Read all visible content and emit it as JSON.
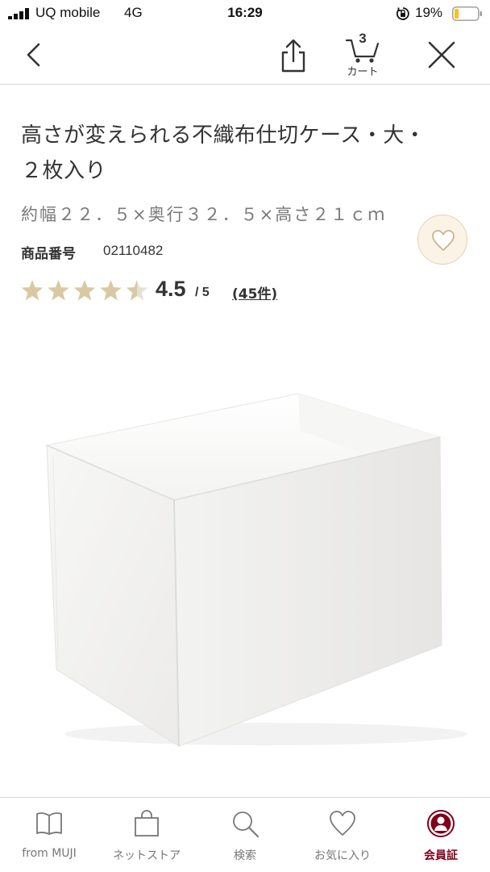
{
  "status_bar": {
    "carrier": "UQ mobile",
    "network": "4G",
    "time": "16:29",
    "battery": "19%",
    "battery_level": 0.19,
    "icons": [
      "signal-icon",
      "orientation-lock-icon",
      "battery-icon"
    ]
  },
  "nav": {
    "icons": [
      "chevron-left-icon",
      "share-icon",
      "cart-icon",
      "close-icon"
    ],
    "cart_count": "3",
    "cart_label": "カート"
  },
  "product": {
    "title_line1": "高さが変えられる不織布仕切ケース・大・",
    "title_line2": "２枚入り",
    "size": "約幅２２．５×奥行３２．５×高さ２１ｃｍ",
    "product_number_label": "商品番号",
    "product_number": "02110482",
    "rating": "4.5",
    "rating_max": "/ 5",
    "rating_value": 4.5,
    "review_count": "(45件)",
    "favorite_icon": "heart-icon"
  },
  "tabs": [
    {
      "label": "from MUJI",
      "icon": "book-icon"
    },
    {
      "label": "ネットストア",
      "icon": "shopping-bag-icon"
    },
    {
      "label": "検索",
      "icon": "search-icon"
    },
    {
      "label": "お気に入り",
      "icon": "heart-icon"
    },
    {
      "label": "会員証",
      "icon": "member-card-icon",
      "active": true
    }
  ],
  "colors": {
    "star": "#d9c9a3",
    "star_empty": "#e6e1d6",
    "favorite_bg": "#fbf3e6",
    "favorite_border": "#e1d2b4",
    "accent": "#7f0019",
    "text": "#333333"
  }
}
